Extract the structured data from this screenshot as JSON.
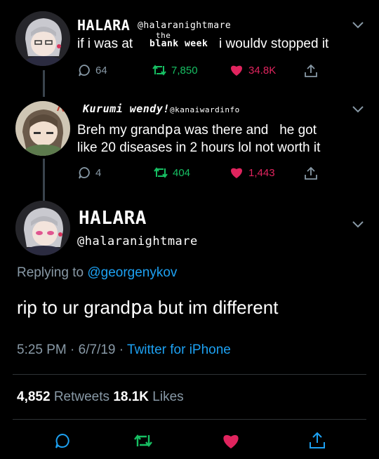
{
  "tweet1": {
    "display_name": "HALARA",
    "handle": "@halaranightmare",
    "text_before": "if i was at",
    "inserted_top": "the",
    "inserted_bottom": "blank week",
    "text_after": "i wouldv stopped it",
    "replies": "64",
    "retweets": "7,850",
    "likes": "34.8K"
  },
  "tweet2": {
    "display_name": "Kurumi wendy!",
    "handle": "@kanaiwardinfo",
    "line1_a": "Breh my grand",
    "line1_p": "p",
    "line1_b": "a was there and   he got",
    "line2": "like 20 diseases in 2 hours lol not worth it",
    "replies": "4",
    "retweets": "404",
    "likes": "1,443"
  },
  "main_tweet": {
    "display_name": "HALARA",
    "handle": "@halaranightmare",
    "replying_label": "Replying to",
    "replying_to": "@georgenykov",
    "text_a": "rip to ur grand",
    "text_p": "p",
    "text_b": "a but im different",
    "time": "5:25 PM",
    "date": "6/7/19",
    "dot": "·",
    "client": "Twitter for iPhone",
    "retweet_count": "4,852",
    "retweet_label": "Retweets",
    "like_count": "18.1K",
    "like_label": "Likes"
  },
  "colors": {
    "background": "#000000",
    "secondary_text": "#8899a6",
    "link": "#1da1f2",
    "retweet_green": "#17bf63",
    "like_red": "#e0245e",
    "thread_line": "#3a444d"
  },
  "icons": [
    "reply-icon",
    "retweet-icon",
    "like-heart-icon",
    "share-icon",
    "chevron-down-icon"
  ]
}
